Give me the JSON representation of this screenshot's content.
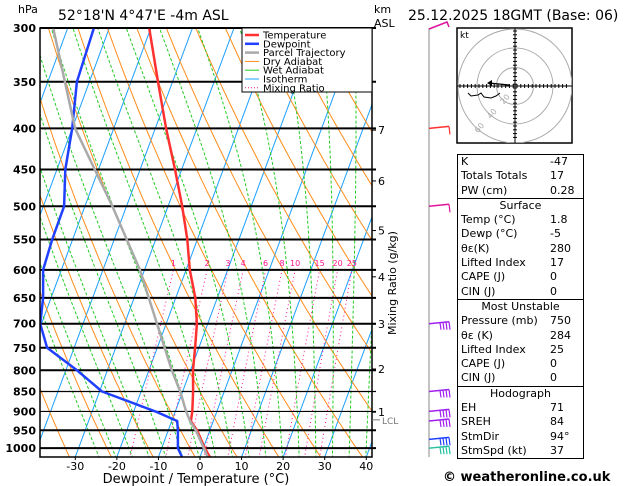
{
  "header": {
    "hpa_label": "hPa",
    "location": "52°18'N 4°47'E -4m ASL",
    "km_label": "km",
    "asl_label": "ASL",
    "datetime": "25.12.2025 18GMT (Base: 06)"
  },
  "footer": {
    "copyright": "© weatheronline.co.uk"
  },
  "colors": {
    "temperature": "#ff3030",
    "dewpoint": "#2040ff",
    "parcel": "#aaaaaa",
    "dry_adiabat": "#ff8c1a",
    "wet_adiabat": "#22cc22",
    "isotherm": "#1aa0ff",
    "mixing_ratio": "#ff1493"
  },
  "chart_data": {
    "type": "skew-t",
    "xlabel": "Dewpoint / Temperature (°C)",
    "ylabel": "hPa",
    "secondary_ylabel": "Mixing Ratio (g/kg)",
    "xlim": [
      -40,
      40
    ],
    "ylim": [
      1026,
      300
    ],
    "x_ticks": [
      -30,
      -20,
      -10,
      0,
      10,
      20,
      30,
      40
    ],
    "pressure_ticks": [
      300,
      350,
      400,
      450,
      500,
      550,
      600,
      650,
      700,
      750,
      800,
      850,
      900,
      950,
      1000
    ],
    "height_ticks_km": [
      {
        "km": "1",
        "p": 902
      },
      {
        "km": "2",
        "p": 797
      },
      {
        "km": "3",
        "p": 701
      },
      {
        "km": "4",
        "p": 612
      },
      {
        "km": "5",
        "p": 536
      },
      {
        "km": "6",
        "p": 465
      },
      {
        "km": "7",
        "p": 402
      }
    ],
    "lcl": {
      "label": "LCL",
      "p": 922
    },
    "mixing_ratio_labels": [
      1,
      2,
      3,
      4,
      6,
      8,
      10,
      15,
      20,
      25
    ],
    "legend": {
      "position": "top-right",
      "entries": [
        "Temperature",
        "Dewpoint",
        "Parcel Trajectory",
        "Dry Adiabat",
        "Wet Adiabat",
        "Isotherm",
        "Mixing Ratio"
      ]
    },
    "series": [
      {
        "name": "Temperature",
        "p": [
          1026,
          1000,
          950,
          925,
          900,
          850,
          800,
          750,
          700,
          650,
          600,
          550,
          500,
          450,
          400,
          350,
          300
        ],
        "t": [
          2.4,
          0.4,
          -3.1,
          -5.4,
          -5.9,
          -7.5,
          -9.4,
          -10.9,
          -12.6,
          -15.3,
          -19.1,
          -22.4,
          -26.6,
          -31.6,
          -37.4,
          -43.5,
          -50.4
        ]
      },
      {
        "name": "Dewpoint",
        "p": [
          1026,
          1000,
          950,
          925,
          900,
          850,
          800,
          750,
          700,
          650,
          600,
          550,
          500,
          450,
          400,
          350,
          300
        ],
        "t": [
          -4.3,
          -6.1,
          -7.7,
          -8.7,
          -14.8,
          -29.4,
          -37.3,
          -46.5,
          -50.3,
          -51.9,
          -54.4,
          -54.9,
          -55.0,
          -58.0,
          -60.0,
          -63.0,
          -63.7
        ]
      },
      {
        "name": "Parcel Trajectory",
        "p": [
          1026,
          950,
          925,
          900,
          850,
          800,
          700,
          600,
          500,
          400,
          350,
          300
        ],
        "t": [
          1.9,
          -3.4,
          -5.6,
          -7.4,
          -10.6,
          -14.5,
          -22.2,
          -31.1,
          -43.4,
          -59.3,
          -65.9,
          -73.5
        ]
      }
    ],
    "wind_barbs": [
      {
        "p": 300,
        "color": "#e0139c"
      },
      {
        "p": 400,
        "color": "#ff3030"
      },
      {
        "p": 500,
        "color": "#e0139c"
      },
      {
        "p": 700,
        "color": "#a020f0"
      },
      {
        "p": 850,
        "color": "#a020f0"
      },
      {
        "p": 900,
        "color": "#a020f0"
      },
      {
        "p": 925,
        "color": "#a020f0"
      },
      {
        "p": 975,
        "color": "#2040ff"
      },
      {
        "p": 1000,
        "color": "#20c0a0"
      }
    ]
  },
  "hodograph": {
    "unit": "kt",
    "rings": [
      "20",
      "40",
      "60"
    ]
  },
  "indices": {
    "general": [
      {
        "label": "K",
        "value": "-47"
      },
      {
        "label": "Totals Totals",
        "value": "17"
      },
      {
        "label": "PW (cm)",
        "value": "0.28"
      }
    ],
    "surface": {
      "title": "Surface",
      "rows": [
        {
          "label": "Temp (°C)",
          "value": "1.8"
        },
        {
          "label": "Dewp (°C)",
          "value": "-5"
        },
        {
          "label": "θε(K)",
          "value": "280"
        },
        {
          "label": "Lifted Index",
          "value": "17"
        },
        {
          "label": "CAPE (J)",
          "value": "0"
        },
        {
          "label": "CIN (J)",
          "value": "0"
        }
      ]
    },
    "most_unstable": {
      "title": "Most Unstable",
      "rows": [
        {
          "label": "Pressure (mb)",
          "value": "750"
        },
        {
          "label": "θε (K)",
          "value": "284"
        },
        {
          "label": "Lifted Index",
          "value": "25"
        },
        {
          "label": "CAPE (J)",
          "value": "0"
        },
        {
          "label": "CIN (J)",
          "value": "0"
        }
      ]
    },
    "hodograph": {
      "title": "Hodograph",
      "rows": [
        {
          "label": "EH",
          "value": "71"
        },
        {
          "label": "SREH",
          "value": "84"
        },
        {
          "label": "StmDir",
          "value": "94°"
        },
        {
          "label": "StmSpd (kt)",
          "value": "37"
        }
      ]
    }
  }
}
